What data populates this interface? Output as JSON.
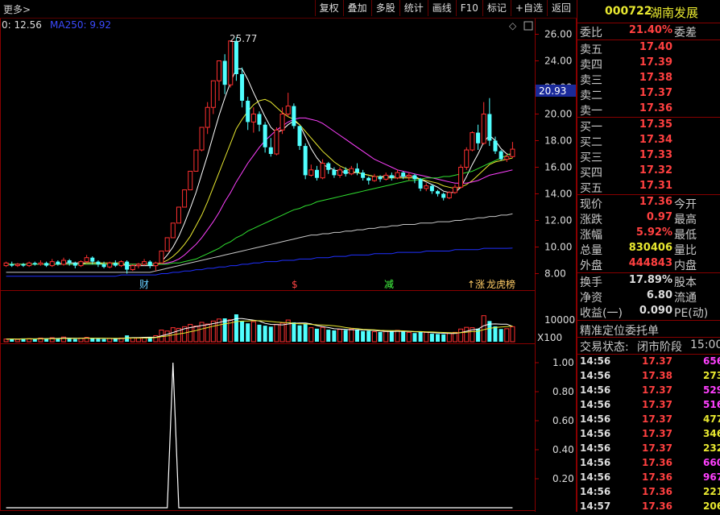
{
  "toolbar": {
    "more": "更多>",
    "buttons": [
      "复权",
      "叠加",
      "多股",
      "统计",
      "画线",
      "F10",
      "标记",
      "+自选",
      "返回"
    ]
  },
  "chart_header": {
    "ma_left": "0: 12.56",
    "ma250": "MA250: 9.92"
  },
  "price_axis": [
    "26.00",
    "24.00",
    "22.00",
    "20.00",
    "18.00",
    "16.00",
    "14.00",
    "12.00",
    "10.00",
    "8.00"
  ],
  "current_price_tag": "20.93",
  "peak_label": "25.77",
  "event_markers": [
    "财",
    "$",
    "减",
    "↑涨",
    "龙虎榜"
  ],
  "volume_axis": [
    "10000"
  ],
  "volume_unit": "X100",
  "indicator_axis": [
    "1.00",
    "0.80",
    "0.60",
    "0.40",
    "0.20"
  ],
  "stock": {
    "code": "000722",
    "name": "湖南发展"
  },
  "weibi": {
    "label": "委比",
    "value": "21.40%",
    "label2": "委差"
  },
  "asks": [
    {
      "label": "卖五",
      "price": "17.40"
    },
    {
      "label": "卖四",
      "price": "17.39"
    },
    {
      "label": "卖三",
      "price": "17.38"
    },
    {
      "label": "卖二",
      "price": "17.37"
    },
    {
      "label": "卖一",
      "price": "17.36"
    }
  ],
  "bids": [
    {
      "label": "买一",
      "price": "17.35"
    },
    {
      "label": "买二",
      "price": "17.34"
    },
    {
      "label": "买三",
      "price": "17.33"
    },
    {
      "label": "买四",
      "price": "17.32"
    },
    {
      "label": "买五",
      "price": "17.31"
    }
  ],
  "quote": [
    {
      "label": "现价",
      "value": "17.36",
      "label2": "今开",
      "color": "red"
    },
    {
      "label": "涨跌",
      "value": "0.97",
      "label2": "最高",
      "color": "red"
    },
    {
      "label": "涨幅",
      "value": "5.92%",
      "label2": "最低",
      "color": "red"
    },
    {
      "label": "总量",
      "value": "830406",
      "label2": "量比",
      "color": "yel"
    },
    {
      "label": "外盘",
      "value": "444843",
      "label2": "内盘",
      "color": "red"
    }
  ],
  "stats": [
    {
      "label": "换手",
      "value": "17.89%",
      "label2": "股本"
    },
    {
      "label": "净资",
      "value": "6.80",
      "label2": "流通"
    },
    {
      "label": "收益(一)",
      "value": "0.090",
      "label2": "PE(动)"
    }
  ],
  "precise_order": "精准定位委托单",
  "trade_status": {
    "label": "交易状态:",
    "value": "闭市阶段",
    "time": "15:00"
  },
  "ticks": [
    {
      "time": "14:56",
      "price": "17.37",
      "vol": "656",
      "color": "mag"
    },
    {
      "time": "14:56",
      "price": "17.38",
      "vol": "273",
      "color": "yel"
    },
    {
      "time": "14:56",
      "price": "17.37",
      "vol": "529",
      "color": "mag"
    },
    {
      "time": "14:56",
      "price": "17.37",
      "vol": "516",
      "color": "mag"
    },
    {
      "time": "14:56",
      "price": "17.37",
      "vol": "477",
      "color": "yel"
    },
    {
      "time": "14:56",
      "price": "17.37",
      "vol": "346",
      "color": "yel"
    },
    {
      "time": "14:56",
      "price": "17.37",
      "vol": "232",
      "color": "yel"
    },
    {
      "time": "14:56",
      "price": "17.36",
      "vol": "660",
      "color": "mag"
    },
    {
      "time": "14:56",
      "price": "17.36",
      "vol": "967",
      "color": "mag"
    },
    {
      "time": "14:56",
      "price": "17.36",
      "vol": "221",
      "color": "yel"
    },
    {
      "time": "14:57",
      "price": "17.36",
      "vol": "206",
      "color": "yel"
    }
  ],
  "chart_data": {
    "type": "candlestick",
    "ylim": [
      7,
      27
    ],
    "candles": [
      [
        8.6,
        8.8,
        8.5,
        8.9
      ],
      [
        8.7,
        8.6,
        8.5,
        8.9
      ],
      [
        8.6,
        8.7,
        8.5,
        8.8
      ],
      [
        8.7,
        8.6,
        8.5,
        8.8
      ],
      [
        8.6,
        8.8,
        8.5,
        8.9
      ],
      [
        8.8,
        8.7,
        8.6,
        8.9
      ],
      [
        8.7,
        8.8,
        8.6,
        9.0
      ],
      [
        8.8,
        8.6,
        8.5,
        8.9
      ],
      [
        8.6,
        8.9,
        8.5,
        9.1
      ],
      [
        8.9,
        8.7,
        8.6,
        9.0
      ],
      [
        8.7,
        9.0,
        8.6,
        9.2
      ],
      [
        9.0,
        8.8,
        8.6,
        9.1
      ],
      [
        8.8,
        8.6,
        8.4,
        8.9
      ],
      [
        8.6,
        8.9,
        8.5,
        9.0
      ],
      [
        8.9,
        9.2,
        8.8,
        9.4
      ],
      [
        9.2,
        8.9,
        8.7,
        9.3
      ],
      [
        8.9,
        8.7,
        8.5,
        9.0
      ],
      [
        8.7,
        8.5,
        8.4,
        8.9
      ],
      [
        8.5,
        8.8,
        8.4,
        8.9
      ],
      [
        8.8,
        8.6,
        8.5,
        9.0
      ],
      [
        8.6,
        8.9,
        8.5,
        9.0
      ],
      [
        8.9,
        8.3,
        8.0,
        9.0
      ],
      [
        8.3,
        8.6,
        8.2,
        8.7
      ],
      [
        8.6,
        8.7,
        8.4,
        8.8
      ],
      [
        8.7,
        8.9,
        8.6,
        9.1
      ],
      [
        8.9,
        8.6,
        8.4,
        9.0
      ],
      [
        8.6,
        8.8,
        8.2,
        8.9
      ],
      [
        8.8,
        9.7,
        8.8,
        9.7
      ],
      [
        9.7,
        10.7,
        9.7,
        10.7
      ],
      [
        10.7,
        11.8,
        10.7,
        11.8
      ],
      [
        11.8,
        13.0,
        11.8,
        13.0
      ],
      [
        13.0,
        14.3,
        13.0,
        14.3
      ],
      [
        14.3,
        15.7,
        14.3,
        15.7
      ],
      [
        15.7,
        17.3,
        15.7,
        17.3
      ],
      [
        17.3,
        19.0,
        17.2,
        19.0
      ],
      [
        19.0,
        20.5,
        18.5,
        20.9
      ],
      [
        20.5,
        22.5,
        20.0,
        22.5
      ],
      [
        22.5,
        24.0,
        21.0,
        24.0
      ],
      [
        24.0,
        22.2,
        21.5,
        24.5
      ],
      [
        22.2,
        25.5,
        22.0,
        25.5
      ],
      [
        25.5,
        23.0,
        22.5,
        25.77
      ],
      [
        23.0,
        21.0,
        20.5,
        23.5
      ],
      [
        21.0,
        19.4,
        18.8,
        21.3
      ],
      [
        19.4,
        20.0,
        18.6,
        20.5
      ],
      [
        20.0,
        19.2,
        18.7,
        20.2
      ],
      [
        19.2,
        17.5,
        17.1,
        19.4
      ],
      [
        17.5,
        17.0,
        16.8,
        18.2
      ],
      [
        17.0,
        18.8,
        16.9,
        19.0
      ],
      [
        18.8,
        20.0,
        18.5,
        20.5
      ],
      [
        20.0,
        20.6,
        19.8,
        21.6
      ],
      [
        20.6,
        19.1,
        18.9,
        20.8
      ],
      [
        19.1,
        17.6,
        17.3,
        19.1
      ],
      [
        17.6,
        15.4,
        15.1,
        17.8
      ],
      [
        15.4,
        15.8,
        15.3,
        16.2
      ],
      [
        15.8,
        15.2,
        15.0,
        16.1
      ],
      [
        15.2,
        16.3,
        15.1,
        16.6
      ],
      [
        16.3,
        15.8,
        15.5,
        16.4
      ],
      [
        15.8,
        15.4,
        15.2,
        16.0
      ],
      [
        15.4,
        15.8,
        15.2,
        16.0
      ],
      [
        15.8,
        15.5,
        15.3,
        16.0
      ],
      [
        15.5,
        15.9,
        15.4,
        16.1
      ],
      [
        15.9,
        15.6,
        15.4,
        16.3
      ],
      [
        15.6,
        15.2,
        15.0,
        15.8
      ],
      [
        15.2,
        15.0,
        14.7,
        15.3
      ],
      [
        15.0,
        15.3,
        14.9,
        15.5
      ],
      [
        15.3,
        15.1,
        14.9,
        15.4
      ],
      [
        15.1,
        15.4,
        15.0,
        15.6
      ],
      [
        15.4,
        15.2,
        15.0,
        15.6
      ],
      [
        15.2,
        15.6,
        15.1,
        15.8
      ],
      [
        15.6,
        15.3,
        15.1,
        15.7
      ],
      [
        15.3,
        15.4,
        15.0,
        15.6
      ],
      [
        15.4,
        15.1,
        14.8,
        15.5
      ],
      [
        15.1,
        14.4,
        14.2,
        15.2
      ],
      [
        14.4,
        14.6,
        14.2,
        14.8
      ],
      [
        14.6,
        14.2,
        14.0,
        14.7
      ],
      [
        14.2,
        14.0,
        13.8,
        14.3
      ],
      [
        14.0,
        13.7,
        13.5,
        14.1
      ],
      [
        13.7,
        14.1,
        13.6,
        14.2
      ],
      [
        14.1,
        14.5,
        14.0,
        14.7
      ],
      [
        14.5,
        16.0,
        14.4,
        16.2
      ],
      [
        16.0,
        17.3,
        15.8,
        17.5
      ],
      [
        17.3,
        18.6,
        17.2,
        18.7
      ],
      [
        18.6,
        17.8,
        17.3,
        19.2
      ],
      [
        17.8,
        20.0,
        17.7,
        20.9
      ],
      [
        20.0,
        18.0,
        17.6,
        21.2
      ],
      [
        18.0,
        17.2,
        17.0,
        18.3
      ],
      [
        17.2,
        16.6,
        16.5,
        17.3
      ],
      [
        16.6,
        16.8,
        16.4,
        17.0
      ],
      [
        16.8,
        17.36,
        16.7,
        17.9
      ]
    ],
    "ma_lines": [
      {
        "color": "#ffffff",
        "values": [
          8.7,
          8.7,
          8.7,
          8.7,
          8.7,
          8.7,
          8.7,
          8.7,
          8.7,
          8.7,
          8.8,
          8.8,
          8.8,
          8.8,
          8.8,
          8.8,
          8.8,
          8.7,
          8.7,
          8.7,
          8.7,
          8.6,
          8.6,
          8.6,
          8.6,
          8.6,
          8.6,
          8.9,
          9.4,
          10.0,
          10.8,
          11.8,
          12.9,
          14.1,
          15.5,
          16.9,
          18.4,
          19.9,
          21.2,
          22.4,
          23.4,
          23.4,
          22.6,
          21.6,
          20.7,
          19.8,
          19.0,
          18.6,
          18.8,
          19.2,
          19.5,
          19.2,
          18.3,
          17.4,
          16.7,
          16.2,
          16.0,
          15.8,
          15.7,
          15.6,
          15.6,
          15.6,
          15.5,
          15.4,
          15.3,
          15.3,
          15.3,
          15.3,
          15.3,
          15.3,
          15.3,
          15.3,
          15.1,
          14.9,
          14.7,
          14.5,
          14.2,
          14.1,
          14.1,
          14.5,
          15.3,
          16.2,
          17.0,
          17.9,
          18.4,
          18.0,
          17.4,
          17.0,
          16.9
        ]
      },
      {
        "color": "#e8e830",
        "values": [
          8.7,
          8.7,
          8.7,
          8.7,
          8.7,
          8.7,
          8.7,
          8.7,
          8.7,
          8.7,
          8.7,
          8.7,
          8.7,
          8.7,
          8.8,
          8.8,
          8.8,
          8.8,
          8.8,
          8.8,
          8.8,
          8.7,
          8.7,
          8.7,
          8.7,
          8.7,
          8.7,
          8.8,
          9.0,
          9.3,
          9.7,
          10.2,
          10.8,
          11.6,
          12.4,
          13.4,
          14.5,
          15.6,
          16.7,
          17.8,
          18.9,
          19.6,
          20.2,
          20.7,
          21.0,
          21.1,
          20.9,
          20.5,
          20.1,
          19.8,
          19.6,
          19.2,
          18.7,
          18.2,
          17.7,
          17.2,
          16.8,
          16.4,
          16.1,
          15.9,
          15.7,
          15.6,
          15.5,
          15.4,
          15.3,
          15.3,
          15.2,
          15.2,
          15.2,
          15.2,
          15.2,
          15.2,
          15.1,
          15.0,
          14.9,
          14.8,
          14.6,
          14.5,
          14.4,
          14.5,
          14.7,
          15.0,
          15.4,
          15.8,
          16.2,
          16.4,
          16.5,
          16.6,
          16.7
        ]
      },
      {
        "color": "#ff40ff",
        "values": [
          8.7,
          8.7,
          8.7,
          8.7,
          8.7,
          8.7,
          8.7,
          8.7,
          8.7,
          8.7,
          8.7,
          8.7,
          8.7,
          8.7,
          8.7,
          8.7,
          8.7,
          8.7,
          8.7,
          8.7,
          8.7,
          8.7,
          8.7,
          8.7,
          8.7,
          8.7,
          8.7,
          8.7,
          8.8,
          8.9,
          9.1,
          9.4,
          9.8,
          10.2,
          10.7,
          11.3,
          11.9,
          12.6,
          13.4,
          14.1,
          14.9,
          15.6,
          16.3,
          16.9,
          17.5,
          18.0,
          18.4,
          18.8,
          19.1,
          19.4,
          19.6,
          19.7,
          19.7,
          19.6,
          19.5,
          19.3,
          19.0,
          18.7,
          18.4,
          18.1,
          17.8,
          17.5,
          17.2,
          16.9,
          16.6,
          16.4,
          16.2,
          16.0,
          15.8,
          15.7,
          15.6,
          15.5,
          15.4,
          15.3,
          15.2,
          15.1,
          15.0,
          14.9,
          14.8,
          14.8,
          14.8,
          14.9,
          15.0,
          15.2,
          15.4,
          15.5,
          15.6,
          15.7,
          15.8
        ]
      },
      {
        "color": "#30e030",
        "values": [
          8.7,
          8.7,
          8.7,
          8.7,
          8.7,
          8.7,
          8.7,
          8.7,
          8.7,
          8.7,
          8.7,
          8.7,
          8.7,
          8.7,
          8.7,
          8.7,
          8.7,
          8.7,
          8.7,
          8.7,
          8.7,
          8.7,
          8.7,
          8.7,
          8.7,
          8.7,
          8.7,
          8.7,
          8.7,
          8.8,
          8.8,
          8.9,
          9.0,
          9.1,
          9.3,
          9.5,
          9.7,
          9.9,
          10.2,
          10.4,
          10.7,
          10.9,
          11.2,
          11.4,
          11.6,
          11.8,
          12.0,
          12.2,
          12.4,
          12.6,
          12.8,
          12.9,
          13.1,
          13.2,
          13.4,
          13.5,
          13.6,
          13.7,
          13.8,
          13.9,
          14.0,
          14.1,
          14.2,
          14.3,
          14.4,
          14.5,
          14.6,
          14.7,
          14.8,
          14.9,
          15.0,
          15.0,
          15.1,
          15.2,
          15.2,
          15.2,
          15.3,
          15.3,
          15.4,
          15.5,
          15.6,
          15.7,
          15.9,
          16.1,
          16.3,
          16.5,
          16.7,
          16.9,
          17.1
        ]
      },
      {
        "color": "#c8c8c8",
        "values": [
          8.1,
          8.1,
          8.1,
          8.1,
          8.1,
          8.1,
          8.1,
          8.1,
          8.1,
          8.1,
          8.1,
          8.1,
          8.1,
          8.1,
          8.1,
          8.1,
          8.1,
          8.1,
          8.1,
          8.1,
          8.1,
          8.1,
          8.1,
          8.1,
          8.1,
          8.1,
          8.2,
          8.3,
          8.4,
          8.5,
          8.6,
          8.7,
          8.8,
          8.9,
          9.0,
          9.1,
          9.2,
          9.3,
          9.4,
          9.5,
          9.6,
          9.7,
          9.8,
          9.9,
          10.0,
          10.1,
          10.2,
          10.3,
          10.4,
          10.5,
          10.6,
          10.7,
          10.8,
          10.9,
          10.9,
          11.0,
          11.0,
          11.1,
          11.1,
          11.2,
          11.2,
          11.3,
          11.3,
          11.4,
          11.4,
          11.5,
          11.5,
          11.6,
          11.6,
          11.7,
          11.7,
          11.7,
          11.8,
          11.8,
          11.8,
          11.9,
          11.9,
          11.9,
          12.0,
          12.0,
          12.1,
          12.1,
          12.2,
          12.2,
          12.3,
          12.3,
          12.4,
          12.4,
          12.5
        ]
      },
      {
        "color": "#2030ff",
        "values": [
          7.8,
          7.8,
          7.8,
          7.8,
          7.8,
          7.8,
          7.8,
          7.8,
          7.8,
          7.8,
          7.8,
          7.8,
          7.8,
          7.8,
          7.8,
          7.8,
          7.8,
          7.8,
          7.8,
          7.8,
          7.9,
          7.9,
          7.9,
          7.9,
          7.9,
          7.9,
          7.9,
          8.0,
          8.0,
          8.1,
          8.1,
          8.2,
          8.2,
          8.3,
          8.3,
          8.4,
          8.4,
          8.5,
          8.5,
          8.6,
          8.6,
          8.7,
          8.7,
          8.8,
          8.8,
          8.9,
          8.9,
          8.9,
          9.0,
          9.0,
          9.0,
          9.1,
          9.1,
          9.1,
          9.2,
          9.2,
          9.2,
          9.3,
          9.3,
          9.3,
          9.4,
          9.4,
          9.4,
          9.4,
          9.5,
          9.5,
          9.5,
          9.5,
          9.6,
          9.6,
          9.6,
          9.6,
          9.6,
          9.7,
          9.7,
          9.7,
          9.7,
          9.7,
          9.8,
          9.8,
          9.8,
          9.8,
          9.8,
          9.9,
          9.9,
          9.9,
          9.9,
          9.9,
          9.92
        ]
      }
    ],
    "volume_ylim": [
      0,
      14000
    ],
    "volume": [
      800,
      900,
      700,
      1000,
      900,
      800,
      1100,
      900,
      1200,
      1000,
      1400,
      900,
      800,
      1100,
      1300,
      1000,
      900,
      800,
      1000,
      900,
      1100,
      1900,
      1200,
      1100,
      1300,
      1200,
      1800,
      3500,
      3200,
      4200,
      4000,
      4500,
      5200,
      4700,
      5800,
      5300,
      6200,
      6800,
      7000,
      6600,
      8200,
      6100,
      5500,
      6000,
      5100,
      4800,
      4500,
      5200,
      5600,
      6500,
      5800,
      4900,
      5300,
      4200,
      3900,
      4300,
      3600,
      3400,
      3700,
      3500,
      3800,
      3600,
      3200,
      3300,
      3000,
      2900,
      3100,
      3200,
      3400,
      3000,
      2800,
      2600,
      3000,
      2800,
      2400,
      2300,
      2200,
      2600,
      2800,
      3800,
      4300,
      4200,
      3900,
      7800,
      6200,
      4600,
      3800,
      3900,
      4500
    ],
    "indicator_ylim": [
      0,
      1.1
    ],
    "indicator_spike_index": 29
  }
}
